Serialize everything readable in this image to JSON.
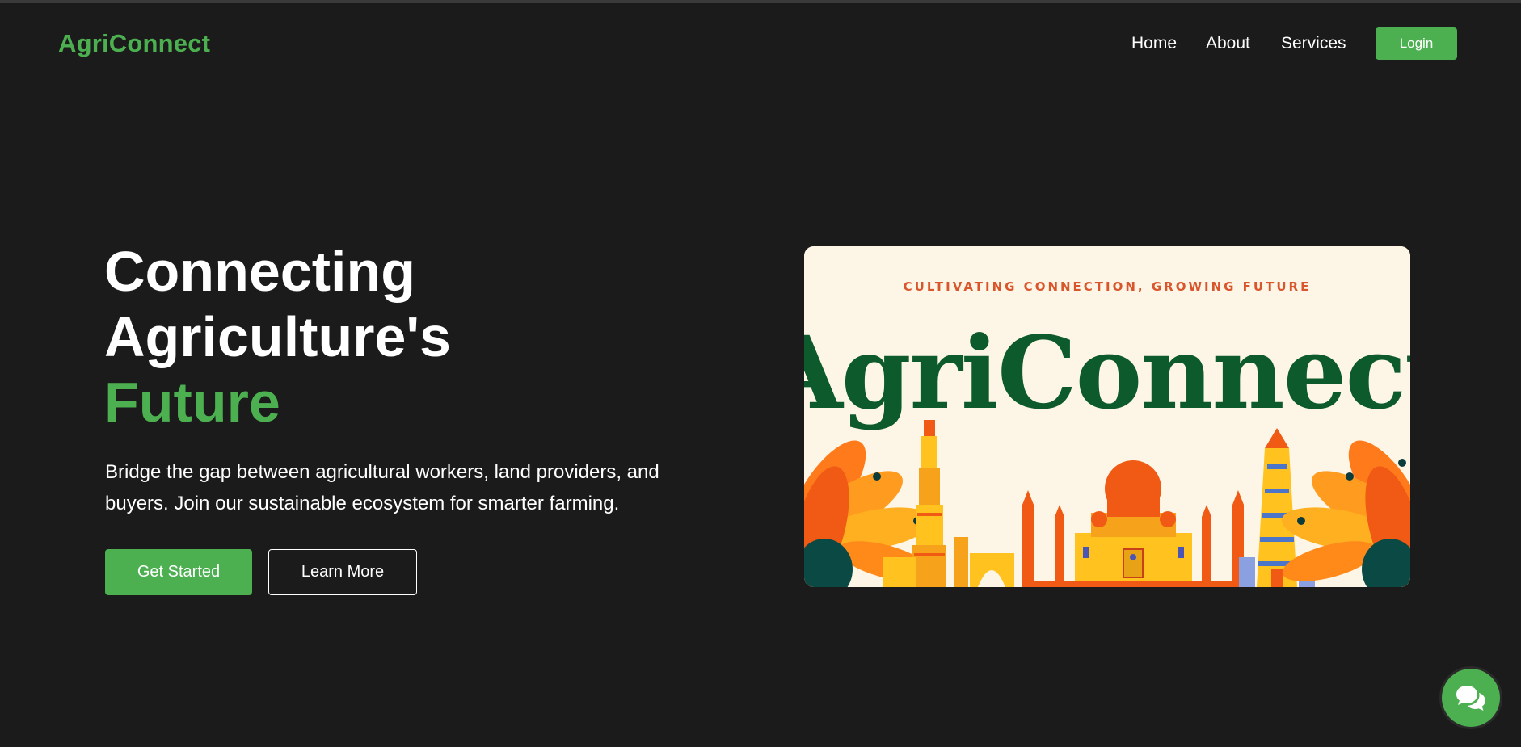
{
  "brand": {
    "name": "AgriConnect",
    "accent_color": "#4caf50"
  },
  "nav": {
    "links": [
      {
        "label": "Home"
      },
      {
        "label": "About"
      },
      {
        "label": "Services"
      }
    ],
    "login_label": "Login"
  },
  "hero": {
    "title_line1": "Connecting",
    "title_line2": "Agriculture's",
    "title_accent": "Future",
    "description": "Bridge the gap between agricultural workers, land providers, and buyers. Join our sustainable ecosystem for smarter farming.",
    "primary_button": "Get Started",
    "secondary_button": "Learn More"
  },
  "banner": {
    "tagline": "CULTIVATING CONNECTION, GROWING FUTURE",
    "wordmark": "AgriConnect"
  },
  "chat": {
    "icon": "chat-bubbles-icon"
  }
}
